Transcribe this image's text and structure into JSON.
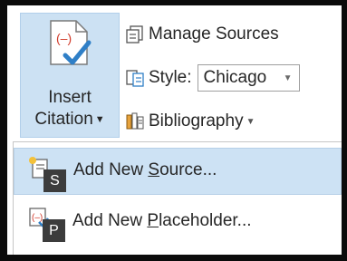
{
  "insert_citation": {
    "label_line1": "Insert",
    "label_line2": "Citation",
    "icon": "citation-mark-icon"
  },
  "commands": {
    "manage_sources": {
      "label": "Manage Sources",
      "icon": "manage-sources-icon"
    },
    "style": {
      "label": "Style:",
      "value": "Chicago",
      "icon": "style-icon"
    },
    "bibliography": {
      "label": "Bibliography",
      "icon": "bibliography-icon"
    }
  },
  "menu": {
    "items": [
      {
        "pre": "Add New ",
        "accel": "S",
        "post": "ource...",
        "keytip": "S",
        "icon": "add-source-icon"
      },
      {
        "pre": "Add New ",
        "accel": "P",
        "post": "laceholder...",
        "keytip": "P",
        "icon": "add-placeholder-icon"
      }
    ]
  },
  "colors": {
    "selected_bg": "#cce1f3",
    "keytip_bg": "#3c3c3c",
    "accent_red": "#d13a2a",
    "accent_blue": "#2f7fc7"
  }
}
